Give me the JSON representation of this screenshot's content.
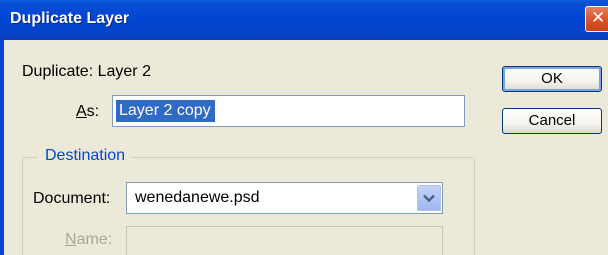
{
  "window": {
    "title": "Duplicate Layer",
    "close_glyph": "✕"
  },
  "duplicate": {
    "prefix": "Duplicate:",
    "layer_name": "Layer 2"
  },
  "as_field": {
    "label_mnemonic": "A",
    "label_rest": "s:",
    "value": "Layer 2 copy"
  },
  "buttons": {
    "ok": "OK",
    "cancel": "Cancel"
  },
  "destination": {
    "group_title": "Destination",
    "document_label": "Document:",
    "document_value": "wenedanewe.psd",
    "name_label_mnemonic": "N",
    "name_label_rest": "ame:",
    "name_value": ""
  },
  "icons": {
    "close": "close-icon",
    "dropdown": "chevron-down-icon"
  },
  "colors": {
    "titlebar": "#0246d4",
    "selection": "#316ac5",
    "group_title": "#0046d5",
    "dialog_bg": "#ece9d8"
  }
}
